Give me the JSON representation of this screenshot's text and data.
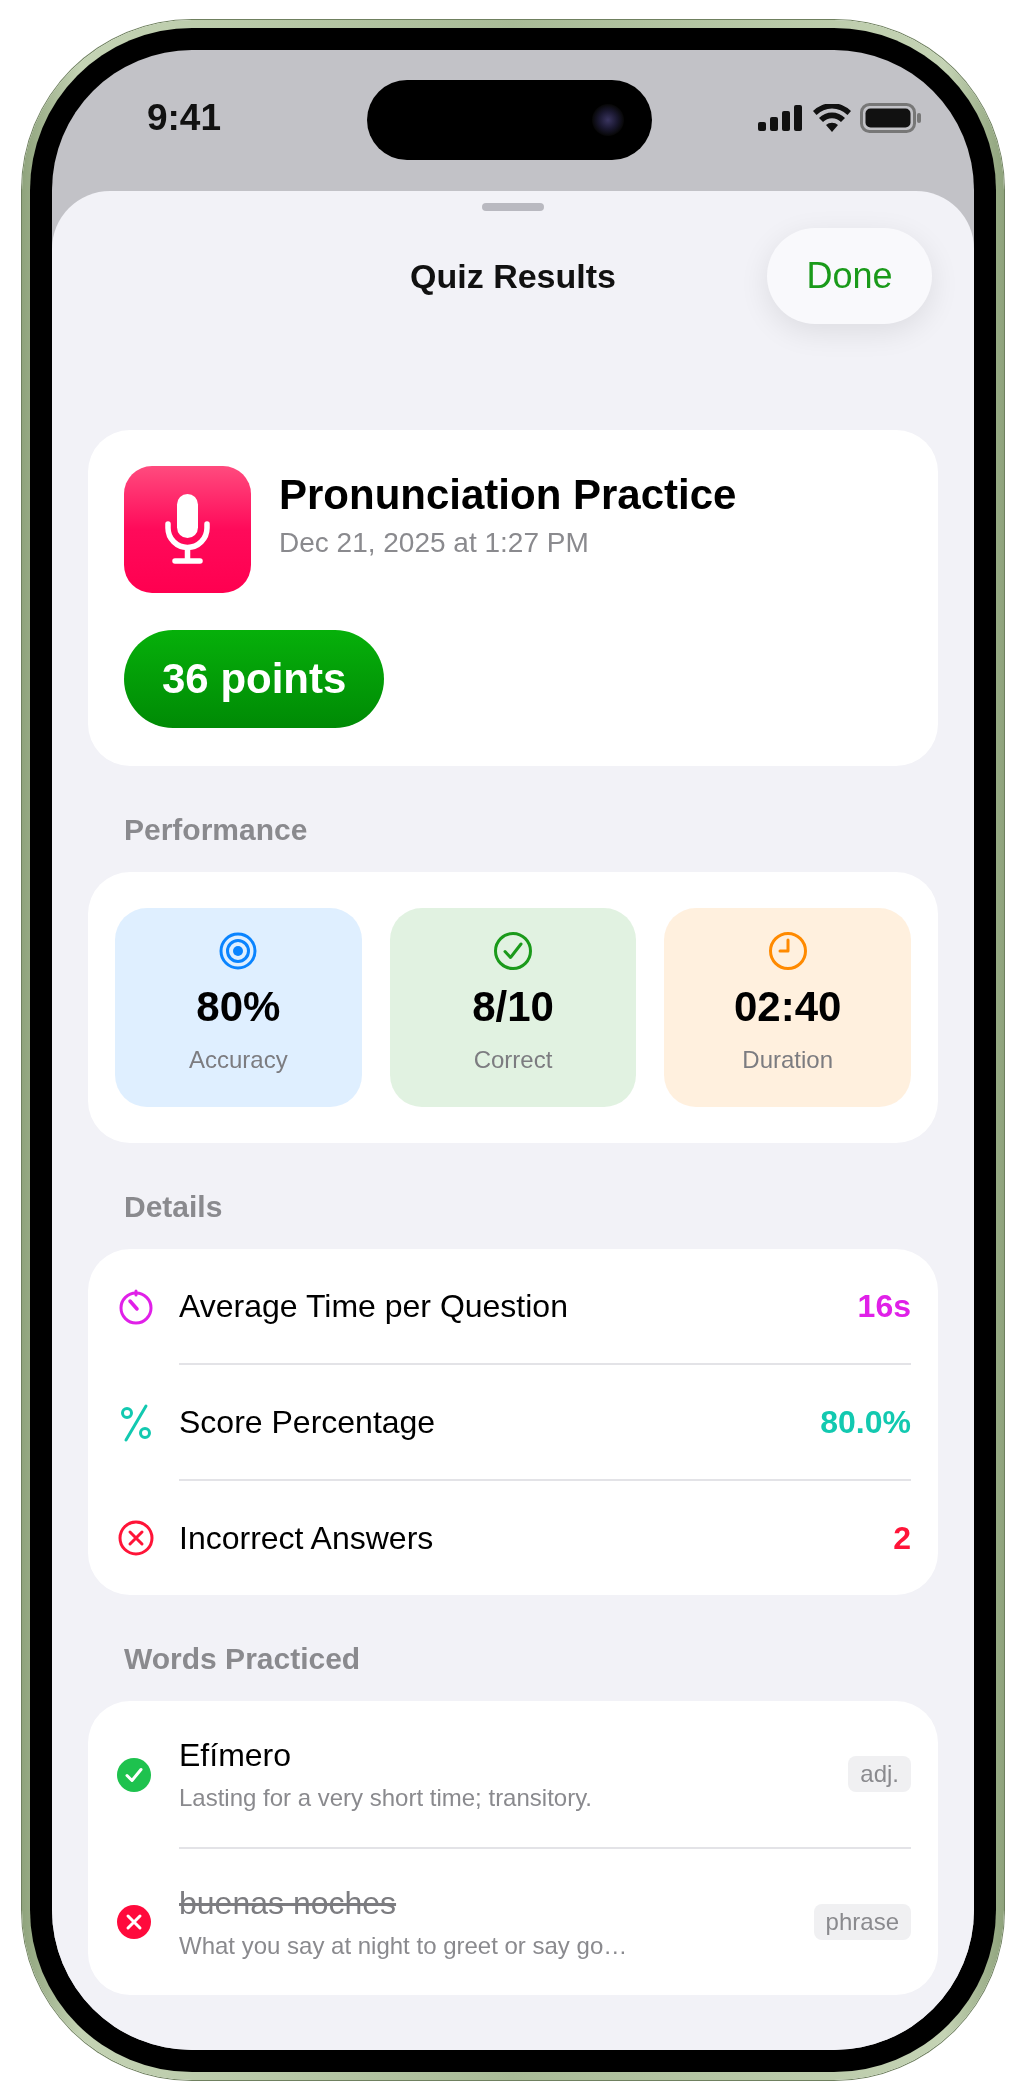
{
  "status_bar": {
    "time": "9:41"
  },
  "nav": {
    "title": "Quiz Results",
    "done_button": "Done"
  },
  "quiz": {
    "title": "Pronunciation Practice",
    "date": "Dec 21, 2025 at 1:27 PM",
    "points": "36 points"
  },
  "performance": {
    "header": "Performance",
    "stats": [
      {
        "kind": "accuracy",
        "value": "80%",
        "label": "Accuracy",
        "color": "#0a84ff"
      },
      {
        "kind": "correct",
        "value": "8/10",
        "label": "Correct",
        "color": "#1a9a1a"
      },
      {
        "kind": "duration",
        "value": "02:40",
        "label": "Duration",
        "color": "#ff8a00"
      }
    ]
  },
  "details": {
    "header": "Details",
    "rows": [
      {
        "kind": "time",
        "label": "Average Time per Question",
        "value": "16s",
        "color": "#e020e8"
      },
      {
        "kind": "percent",
        "label": "Score Percentage",
        "value": "80.0%",
        "color": "#12c9b0"
      },
      {
        "kind": "incorrect",
        "label": "Incorrect Answers",
        "value": "2",
        "color": "#ff1438"
      }
    ]
  },
  "words": {
    "header": "Words Practiced",
    "items": [
      {
        "word": "Efímero",
        "definition": "Lasting for a very short time; transitory.",
        "tag": "adj.",
        "correct": true
      },
      {
        "word": "buenas noches",
        "definition": "What you say at night to greet or say go…",
        "tag": "phrase",
        "correct": false
      }
    ]
  }
}
